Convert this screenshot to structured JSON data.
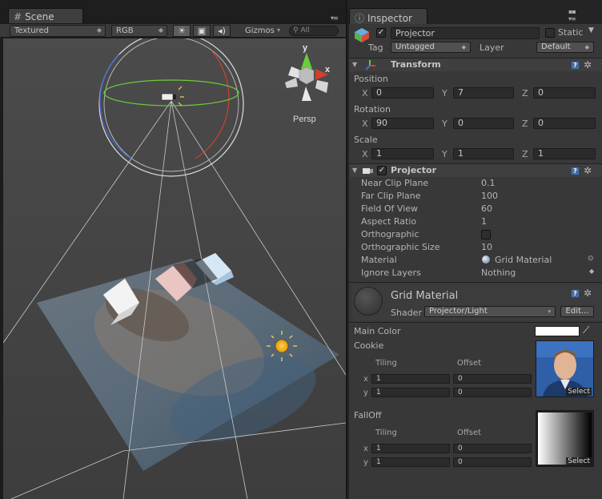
{
  "scene": {
    "tab_label": "Scene",
    "tab_icon": "grid-icon",
    "panel_menu_icon": "panel-menu-icon",
    "toolbar": {
      "render_mode": "Textured",
      "color_mode": "RGB",
      "lighting_icon": "sun-icon",
      "image_icon": "image-icon",
      "audio_icon": "speaker-icon",
      "gizmos_label": "Gizmos",
      "search_placeholder": "All"
    },
    "gizmo": {
      "y_label": "y",
      "x_label": "x",
      "projection_label": "Persp",
      "colors": {
        "x": "#d0402c",
        "y": "#6ccc3c",
        "z": "#3c6cd8"
      }
    }
  },
  "inspector": {
    "tab_label": "Inspector",
    "tab_icon": "info-icon",
    "object": {
      "active": true,
      "name": "Projector",
      "static_label": "Static",
      "static": false,
      "tag_label": "Tag",
      "tag_value": "Untagged",
      "layer_label": "Layer",
      "layer_value": "Default"
    },
    "transform": {
      "title": "Transform",
      "position": {
        "label": "Position",
        "x": "0",
        "y": "7",
        "z": "0"
      },
      "rotation": {
        "label": "Rotation",
        "x": "90",
        "y": "0",
        "z": "0"
      },
      "scale": {
        "label": "Scale",
        "x": "1",
        "y": "1",
        "z": "1"
      },
      "axis_labels": {
        "x": "X",
        "y": "Y",
        "z": "Z"
      }
    },
    "projector": {
      "title": "Projector",
      "enabled": true,
      "properties": [
        {
          "label": "Near Clip Plane",
          "value": "0.1"
        },
        {
          "label": "Far Clip Plane",
          "value": "100"
        },
        {
          "label": "Field Of View",
          "value": "60"
        },
        {
          "label": "Aspect Ratio",
          "value": "1"
        },
        {
          "label": "Orthographic",
          "value": ""
        },
        {
          "label": "Orthographic Size",
          "value": "10"
        },
        {
          "label": "Material",
          "value": "Grid Material"
        },
        {
          "label": "Ignore Layers",
          "value": "Nothing"
        }
      ],
      "orthographic": false
    },
    "material": {
      "name": "Grid Material",
      "shader_label": "Shader",
      "shader_value": "Projector/Light",
      "edit_label": "Edit...",
      "main_color_label": "Main Color",
      "main_color": "#ffffff",
      "cookie_label": "Cookie",
      "falloff_label": "FallOff",
      "tiling_label": "Tiling",
      "offset_label": "Offset",
      "cookie": {
        "x_tiling": "1",
        "x_offset": "0",
        "y_tiling": "1",
        "y_offset": "0"
      },
      "falloff": {
        "x_tiling": "1",
        "x_offset": "0",
        "y_tiling": "1",
        "y_offset": "0"
      },
      "row_x": "x",
      "row_y": "y",
      "select_label": "Select"
    }
  }
}
